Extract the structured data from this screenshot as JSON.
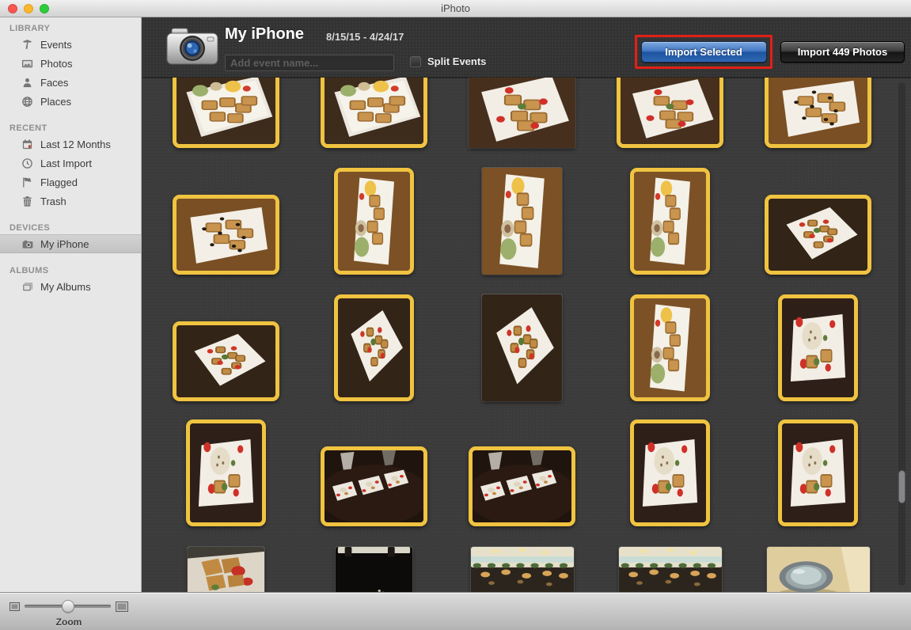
{
  "titlebar": {
    "title": "iPhoto"
  },
  "sidebar": {
    "sections": [
      {
        "label": "LIBRARY",
        "items": [
          {
            "label": "Events",
            "icon": "palm-icon",
            "selected": false
          },
          {
            "label": "Photos",
            "icon": "photo-icon",
            "selected": false
          },
          {
            "label": "Faces",
            "icon": "person-icon",
            "selected": false
          },
          {
            "label": "Places",
            "icon": "globe-icon",
            "selected": false
          }
        ]
      },
      {
        "label": "RECENT",
        "items": [
          {
            "label": "Last 12 Months",
            "icon": "calendar-icon",
            "selected": false
          },
          {
            "label": "Last Import",
            "icon": "clock-icon",
            "selected": false
          },
          {
            "label": "Flagged",
            "icon": "flag-icon",
            "selected": false
          },
          {
            "label": "Trash",
            "icon": "trash-icon",
            "selected": false
          }
        ]
      },
      {
        "label": "DEVICES",
        "items": [
          {
            "label": "My iPhone",
            "icon": "camera-icon",
            "selected": true
          }
        ]
      },
      {
        "label": "ALBUMS",
        "items": [
          {
            "label": "My Albums",
            "icon": "albums-icon",
            "selected": false
          }
        ]
      }
    ]
  },
  "header": {
    "device_name": "My iPhone",
    "date_range": "8/15/15 - 4/24/17",
    "event_name_placeholder": "Add event name...",
    "split_events_label": "Split Events",
    "split_events_checked": false,
    "import_selected_label": "Import Selected",
    "import_all_label": "Import 449 Photos",
    "annotation_color": "#e22017",
    "import_button_color": "#2f67b4"
  },
  "grid": {
    "selection_color": "#f0c340",
    "rows": [
      {
        "photos": [
          {
            "orientation": "landscape",
            "selected": true,
            "variant": "waffle-platter"
          },
          {
            "orientation": "landscape",
            "selected": true,
            "variant": "waffle-platter"
          },
          {
            "orientation": "landscape",
            "selected": false,
            "variant": "waffle-berries"
          },
          {
            "orientation": "landscape",
            "selected": true,
            "variant": "waffle-berries"
          },
          {
            "orientation": "landscape",
            "selected": true,
            "variant": "waffle-blueberry"
          }
        ]
      },
      {
        "photos": [
          {
            "orientation": "landscape",
            "selected": true,
            "variant": "waffle-blueberry"
          },
          {
            "orientation": "portrait",
            "selected": true,
            "variant": "waffle-icecream"
          },
          {
            "orientation": "portrait",
            "selected": false,
            "variant": "waffle-icecream"
          },
          {
            "orientation": "portrait",
            "selected": true,
            "variant": "waffle-icecream"
          },
          {
            "orientation": "landscape",
            "selected": true,
            "variant": "waffle-skewers"
          }
        ]
      },
      {
        "photos": [
          {
            "orientation": "landscape",
            "selected": true,
            "variant": "waffle-skewers"
          },
          {
            "orientation": "portrait",
            "selected": true,
            "variant": "waffle-skewers"
          },
          {
            "orientation": "portrait",
            "selected": false,
            "variant": "waffle-skewers"
          },
          {
            "orientation": "portrait",
            "selected": true,
            "variant": "waffle-icecream"
          },
          {
            "orientation": "portrait",
            "selected": true,
            "variant": "waffle-cream"
          }
        ]
      },
      {
        "photos": [
          {
            "orientation": "portrait",
            "selected": true,
            "variant": "waffle-cream"
          },
          {
            "orientation": "landscape",
            "selected": true,
            "variant": "three-plates"
          },
          {
            "orientation": "landscape",
            "selected": true,
            "variant": "three-plates"
          },
          {
            "orientation": "portrait",
            "selected": true,
            "variant": "waffle-cream"
          },
          {
            "orientation": "portrait",
            "selected": true,
            "variant": "waffle-cream"
          }
        ]
      },
      {
        "photos": [
          {
            "orientation": "small",
            "selected": false,
            "variant": "waffle-closeup"
          },
          {
            "orientation": "small",
            "selected": false,
            "variant": "dark-interior"
          },
          {
            "orientation": "wide",
            "selected": false,
            "variant": "restaurant"
          },
          {
            "orientation": "wide",
            "selected": false,
            "variant": "restaurant"
          },
          {
            "orientation": "wide",
            "selected": false,
            "variant": "latte"
          }
        ]
      }
    ]
  },
  "zoom_control": {
    "label": "Zoom"
  }
}
